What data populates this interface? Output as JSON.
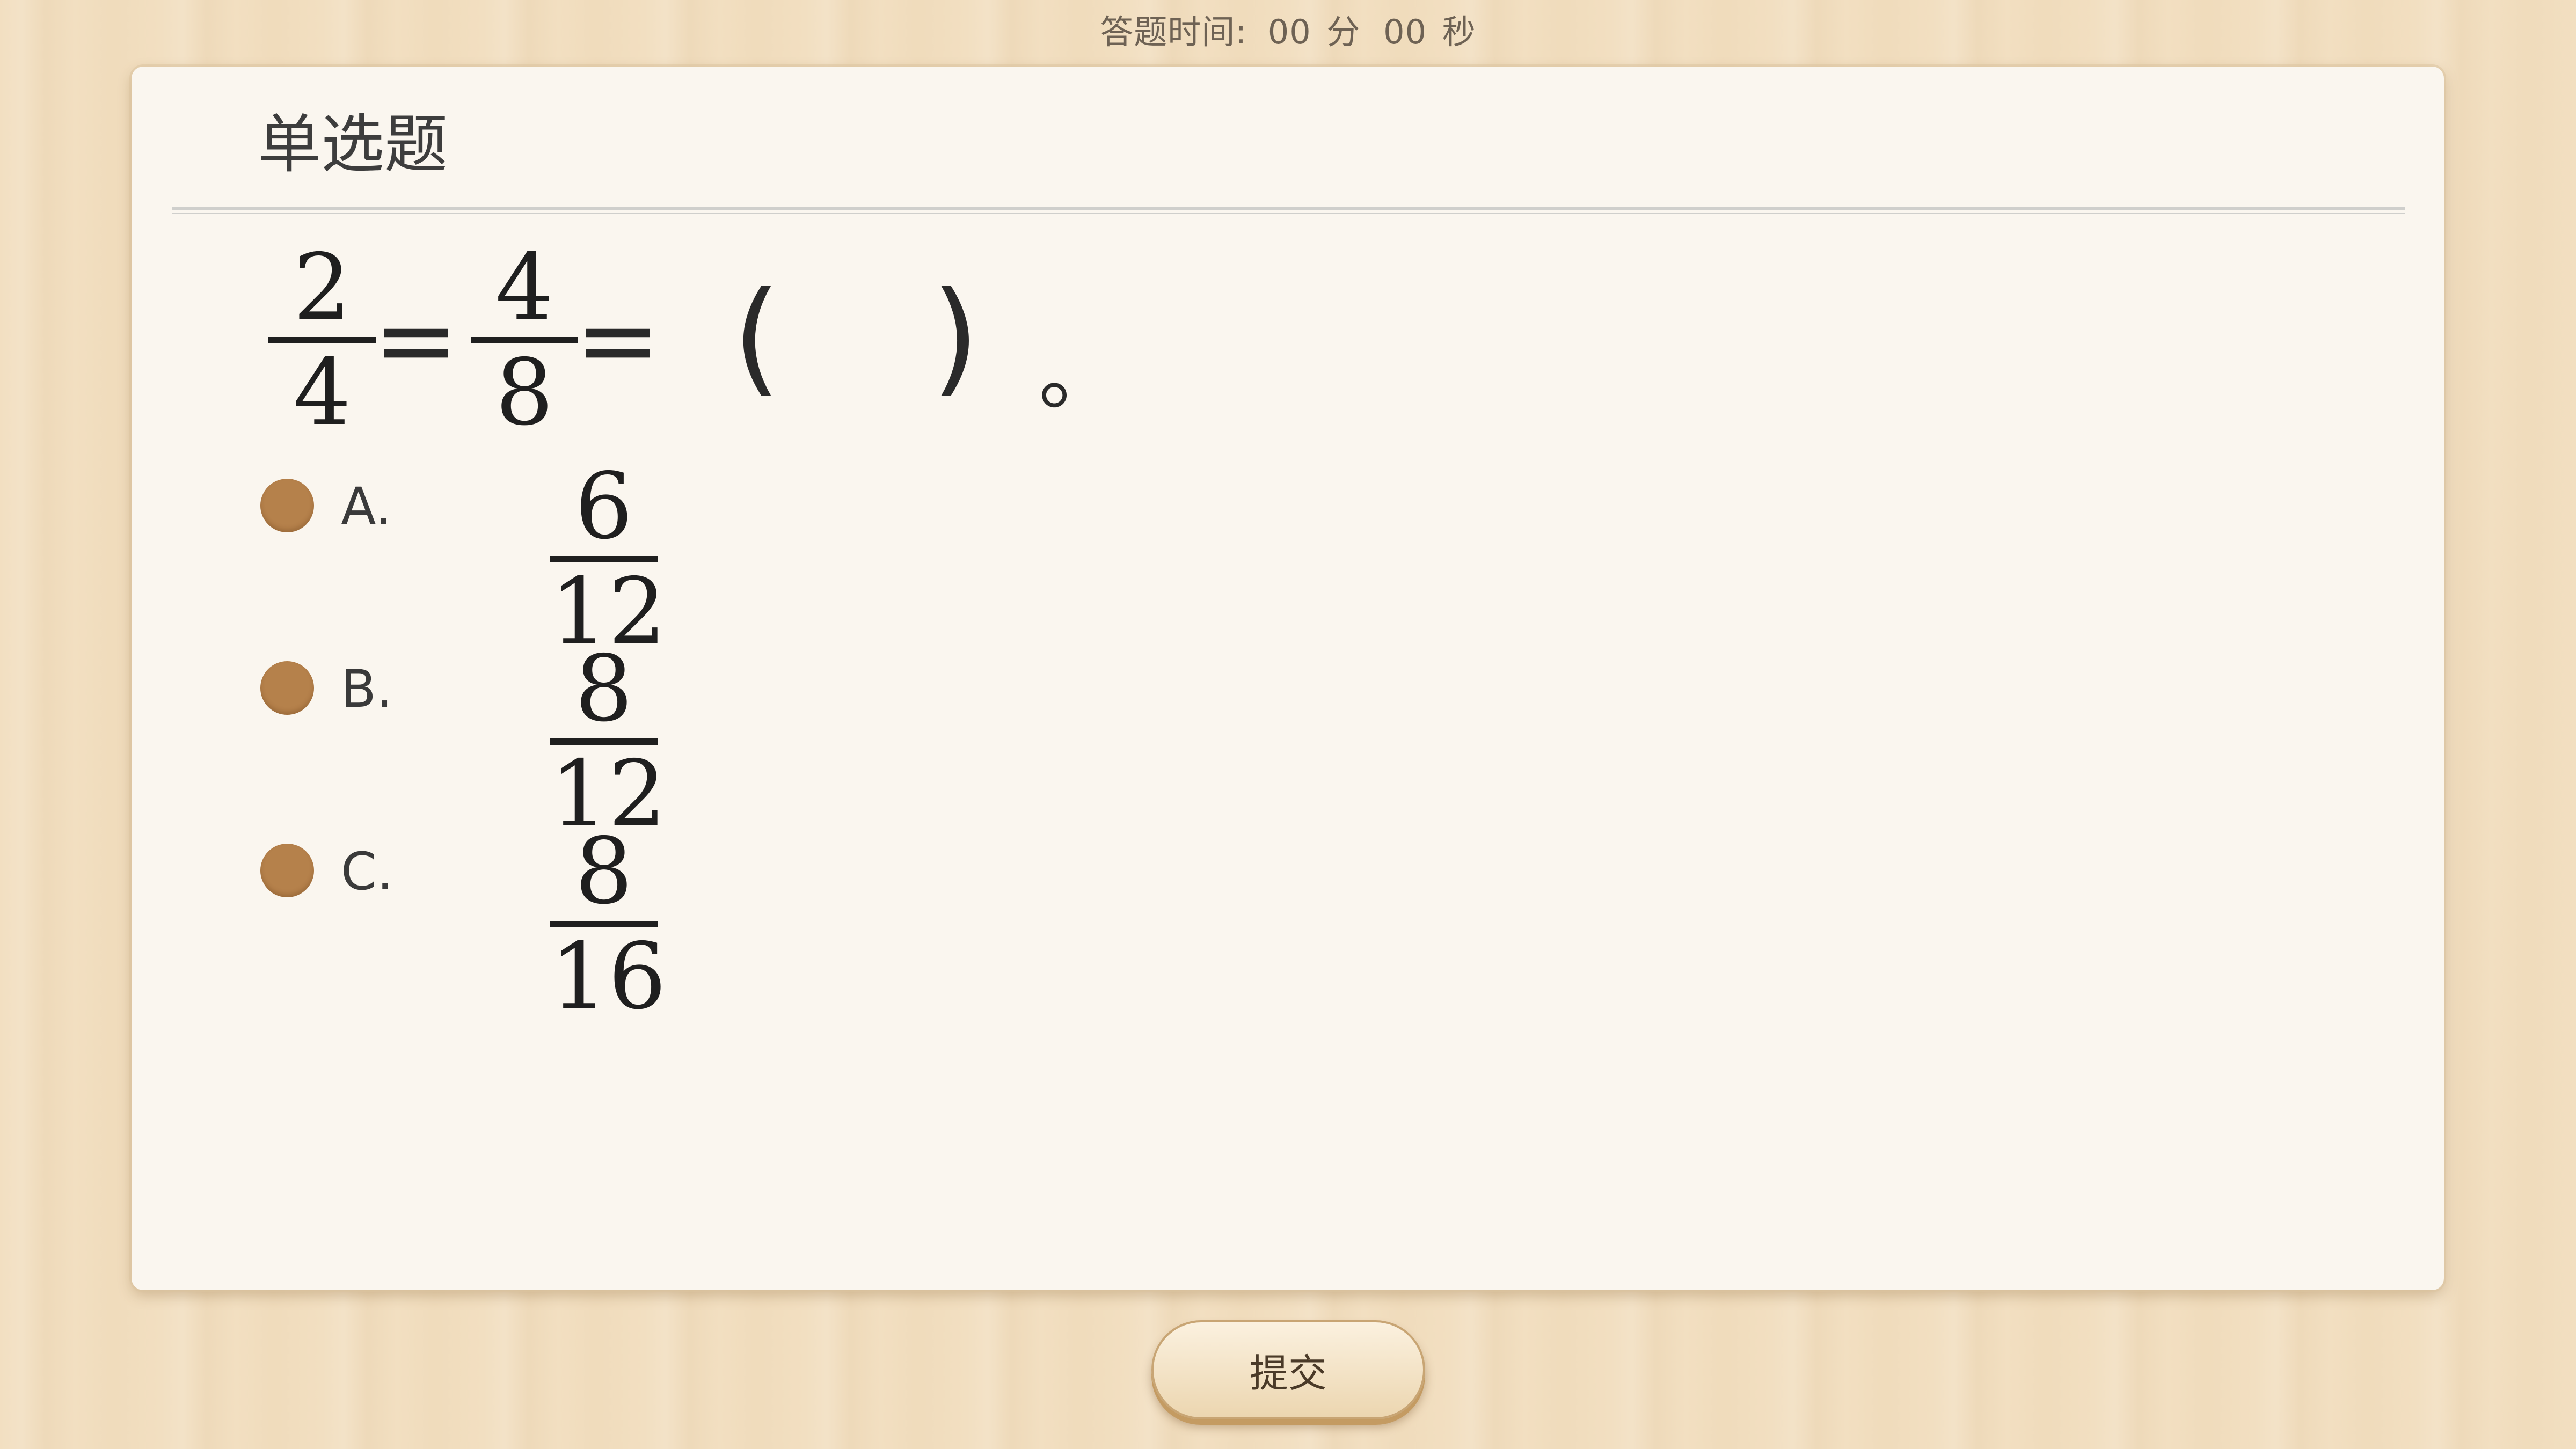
{
  "timer": {
    "label": "答题时间:",
    "minutes": "00",
    "minutes_unit": "分",
    "seconds": "00",
    "seconds_unit": "秒"
  },
  "question": {
    "type_title": "单选题",
    "expr": {
      "frac1": {
        "num": "2",
        "den": "4"
      },
      "eq1": "=",
      "frac2": {
        "num": "4",
        "den": "8"
      },
      "eq2": "=",
      "open_paren": "(",
      "close_paren": ")",
      "period": "。"
    }
  },
  "options": [
    {
      "letter": "A.",
      "num": "6",
      "den": "12"
    },
    {
      "letter": "B.",
      "num": "8",
      "den": "12"
    },
    {
      "letter": "C.",
      "num": "8",
      "den": "16"
    }
  ],
  "submit_label": "提交",
  "colors": {
    "radio": "#b5814b",
    "card_bg": "#faf6ef",
    "wood_bg": "#f2dfc1"
  }
}
